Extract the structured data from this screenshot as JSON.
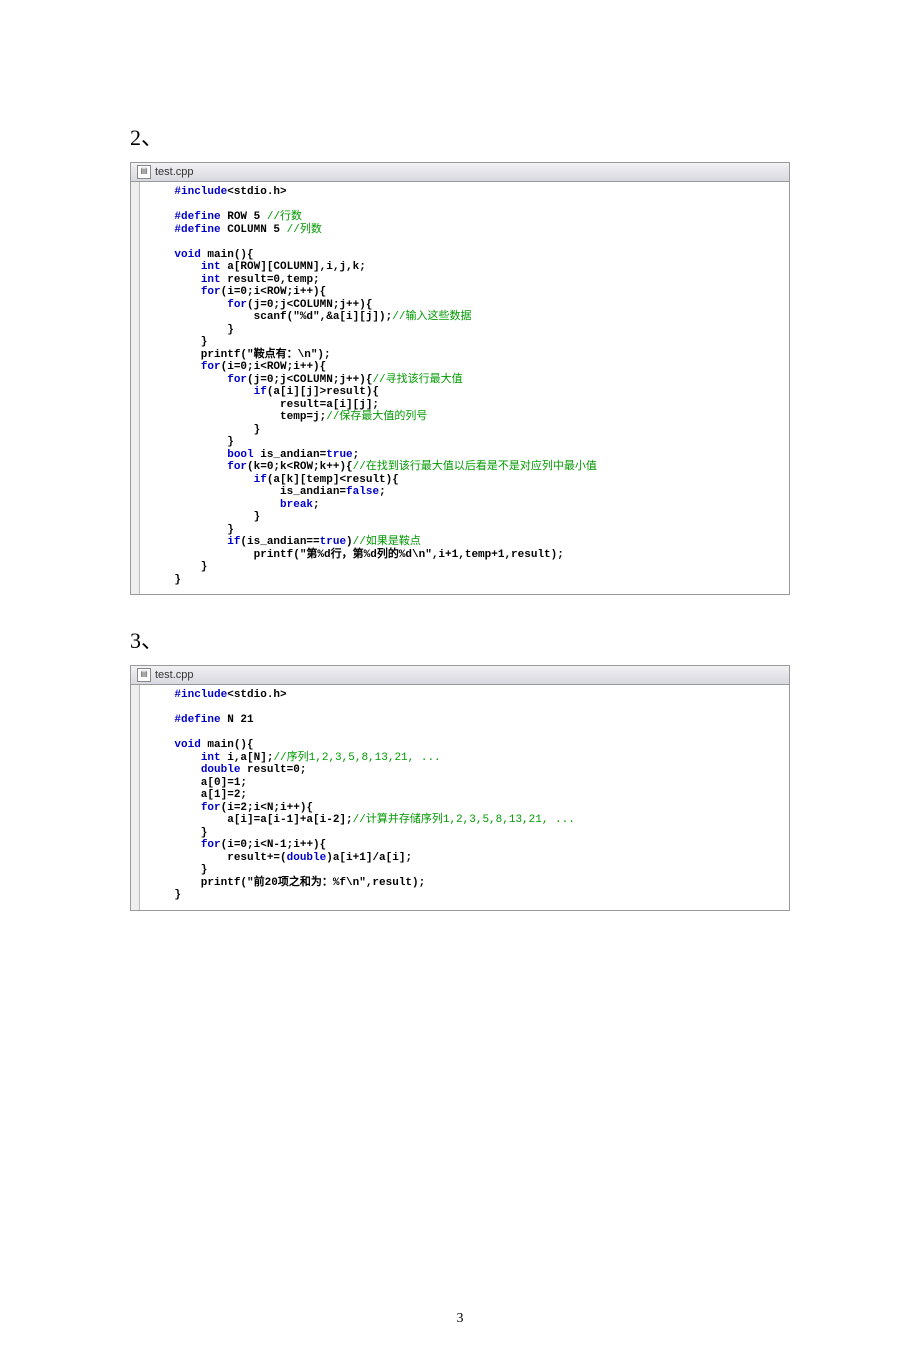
{
  "sections": {
    "s1_num": "2、",
    "s2_num": "3、"
  },
  "window_title": "test.cpp",
  "page_number": "3",
  "code1": {
    "tokens": [
      {
        "t": "    ",
        "c": ""
      },
      {
        "t": "#include",
        "c": "kw"
      },
      {
        "t": "<stdio.h>\n",
        "c": ""
      },
      {
        "t": "\n",
        "c": ""
      },
      {
        "t": "    ",
        "c": ""
      },
      {
        "t": "#define",
        "c": "kw"
      },
      {
        "t": " ROW 5 ",
        "c": ""
      },
      {
        "t": "//行数\n",
        "c": "cm"
      },
      {
        "t": "    ",
        "c": ""
      },
      {
        "t": "#define",
        "c": "kw"
      },
      {
        "t": " COLUMN 5 ",
        "c": ""
      },
      {
        "t": "//列数\n",
        "c": "cm"
      },
      {
        "t": "\n",
        "c": ""
      },
      {
        "t": "    ",
        "c": ""
      },
      {
        "t": "void",
        "c": "kw"
      },
      {
        "t": " main(){\n",
        "c": ""
      },
      {
        "t": "        ",
        "c": ""
      },
      {
        "t": "int",
        "c": "kw"
      },
      {
        "t": " a[ROW][COLUMN],i,j,k;\n",
        "c": ""
      },
      {
        "t": "        ",
        "c": ""
      },
      {
        "t": "int",
        "c": "kw"
      },
      {
        "t": " result=0,temp;\n",
        "c": ""
      },
      {
        "t": "        ",
        "c": ""
      },
      {
        "t": "for",
        "c": "kw"
      },
      {
        "t": "(i=0;i<ROW;i++){\n",
        "c": ""
      },
      {
        "t": "            ",
        "c": ""
      },
      {
        "t": "for",
        "c": "kw"
      },
      {
        "t": "(j=0;j<COLUMN;j++){\n",
        "c": ""
      },
      {
        "t": "                scanf(\"%d\",&a[i][j]);",
        "c": ""
      },
      {
        "t": "//输入这些数据\n",
        "c": "cm"
      },
      {
        "t": "            }\n",
        "c": ""
      },
      {
        "t": "        }\n",
        "c": ""
      },
      {
        "t": "        printf(\"鞍点有：\\n\");\n",
        "c": ""
      },
      {
        "t": "        ",
        "c": ""
      },
      {
        "t": "for",
        "c": "kw"
      },
      {
        "t": "(i=0;i<ROW;i++){\n",
        "c": ""
      },
      {
        "t": "            ",
        "c": ""
      },
      {
        "t": "for",
        "c": "kw"
      },
      {
        "t": "(j=0;j<COLUMN;j++){",
        "c": ""
      },
      {
        "t": "//寻找该行最大值\n",
        "c": "cm"
      },
      {
        "t": "                ",
        "c": ""
      },
      {
        "t": "if",
        "c": "kw"
      },
      {
        "t": "(a[i][j]>result){\n",
        "c": ""
      },
      {
        "t": "                    result=a[i][j];\n",
        "c": ""
      },
      {
        "t": "                    temp=j;",
        "c": ""
      },
      {
        "t": "//保存最大值的列号\n",
        "c": "cm"
      },
      {
        "t": "                }\n",
        "c": ""
      },
      {
        "t": "            }\n",
        "c": ""
      },
      {
        "t": "            ",
        "c": ""
      },
      {
        "t": "bool",
        "c": "kw"
      },
      {
        "t": " is_andian=",
        "c": ""
      },
      {
        "t": "true",
        "c": "kw"
      },
      {
        "t": ";\n",
        "c": ""
      },
      {
        "t": "            ",
        "c": ""
      },
      {
        "t": "for",
        "c": "kw"
      },
      {
        "t": "(k=0;k<ROW;k++){",
        "c": ""
      },
      {
        "t": "//在找到该行最大值以后看是不是对应列中最小值\n",
        "c": "cm"
      },
      {
        "t": "                ",
        "c": ""
      },
      {
        "t": "if",
        "c": "kw"
      },
      {
        "t": "(a[k][temp]<result){\n",
        "c": ""
      },
      {
        "t": "                    is_andian=",
        "c": ""
      },
      {
        "t": "false",
        "c": "kw"
      },
      {
        "t": ";\n",
        "c": ""
      },
      {
        "t": "                    ",
        "c": ""
      },
      {
        "t": "break",
        "c": "kw"
      },
      {
        "t": ";\n",
        "c": ""
      },
      {
        "t": "                }\n",
        "c": ""
      },
      {
        "t": "            }\n",
        "c": ""
      },
      {
        "t": "            ",
        "c": ""
      },
      {
        "t": "if",
        "c": "kw"
      },
      {
        "t": "(is_andian==",
        "c": ""
      },
      {
        "t": "true",
        "c": "kw"
      },
      {
        "t": ")",
        "c": ""
      },
      {
        "t": "//如果是鞍点\n",
        "c": "cm"
      },
      {
        "t": "                printf(\"第%d行，第%d列的%d\\n\",i+1,temp+1,result);\n",
        "c": ""
      },
      {
        "t": "        }\n",
        "c": ""
      },
      {
        "t": "    }\n",
        "c": ""
      }
    ]
  },
  "code2": {
    "tokens": [
      {
        "t": "    ",
        "c": ""
      },
      {
        "t": "#include",
        "c": "kw"
      },
      {
        "t": "<stdio.h>\n",
        "c": ""
      },
      {
        "t": "\n",
        "c": ""
      },
      {
        "t": "    ",
        "c": ""
      },
      {
        "t": "#define",
        "c": "kw"
      },
      {
        "t": " N 21\n",
        "c": ""
      },
      {
        "t": "\n",
        "c": ""
      },
      {
        "t": "    ",
        "c": ""
      },
      {
        "t": "void",
        "c": "kw"
      },
      {
        "t": " main(){\n",
        "c": ""
      },
      {
        "t": "        ",
        "c": ""
      },
      {
        "t": "int",
        "c": "kw"
      },
      {
        "t": " i,a[N];",
        "c": ""
      },
      {
        "t": "//序列1,2,3,5,8,13,21, ...\n",
        "c": "cm"
      },
      {
        "t": "        ",
        "c": ""
      },
      {
        "t": "double",
        "c": "kw"
      },
      {
        "t": " result=0;\n",
        "c": ""
      },
      {
        "t": "        a[0]=1;\n",
        "c": ""
      },
      {
        "t": "        a[1]=2;\n",
        "c": ""
      },
      {
        "t": "        ",
        "c": ""
      },
      {
        "t": "for",
        "c": "kw"
      },
      {
        "t": "(i=2;i<N;i++){\n",
        "c": ""
      },
      {
        "t": "            a[i]=a[i-1]+a[i-2];",
        "c": ""
      },
      {
        "t": "//计算并存储序列1,2,3,5,8,13,21, ...\n",
        "c": "cm"
      },
      {
        "t": "        }\n",
        "c": ""
      },
      {
        "t": "        ",
        "c": ""
      },
      {
        "t": "for",
        "c": "kw"
      },
      {
        "t": "(i=0;i<N-1;i++){\n",
        "c": ""
      },
      {
        "t": "            result+=(",
        "c": ""
      },
      {
        "t": "double",
        "c": "kw"
      },
      {
        "t": ")a[i+1]/a[i];\n",
        "c": ""
      },
      {
        "t": "        }\n",
        "c": ""
      },
      {
        "t": "        printf(\"前20项之和为：%f\\n\",result);\n",
        "c": ""
      },
      {
        "t": "    }\n",
        "c": ""
      }
    ]
  }
}
